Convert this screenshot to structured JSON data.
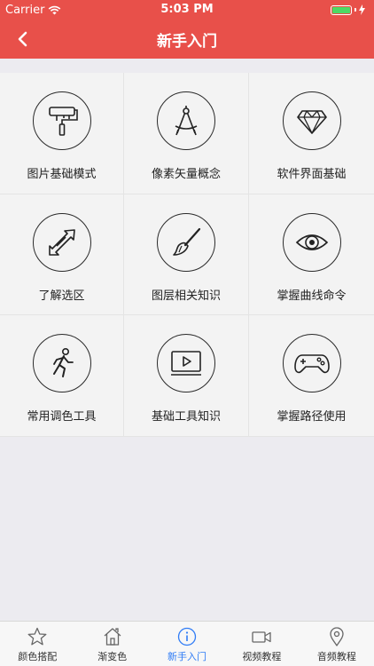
{
  "status": {
    "carrier": "Carrier",
    "time": "5:03 PM"
  },
  "nav": {
    "title": "新手入门"
  },
  "grid": [
    {
      "label": "图片基础模式",
      "icon": "paint-roller-icon"
    },
    {
      "label": "像素矢量概念",
      "icon": "compass-icon"
    },
    {
      "label": "软件界面基础",
      "icon": "diamond-icon"
    },
    {
      "label": "了解选区",
      "icon": "resize-arrows-icon"
    },
    {
      "label": "图层相关知识",
      "icon": "paintbrush-icon"
    },
    {
      "label": "掌握曲线命令",
      "icon": "eye-icon"
    },
    {
      "label": "常用调色工具",
      "icon": "running-person-icon"
    },
    {
      "label": "基础工具知识",
      "icon": "video-screen-icon"
    },
    {
      "label": "掌握路径使用",
      "icon": "gamepad-icon"
    }
  ],
  "tabs": [
    {
      "label": "颜色搭配",
      "icon": "star-icon"
    },
    {
      "label": "渐变色",
      "icon": "home-icon"
    },
    {
      "label": "新手入门",
      "icon": "info-icon",
      "active": true
    },
    {
      "label": "视频教程",
      "icon": "video-camera-icon"
    },
    {
      "label": "音频教程",
      "icon": "location-pin-icon"
    }
  ],
  "colors": {
    "header": "#e8504a",
    "active_tab": "#2f7cf6",
    "background": "#ecebf0"
  }
}
